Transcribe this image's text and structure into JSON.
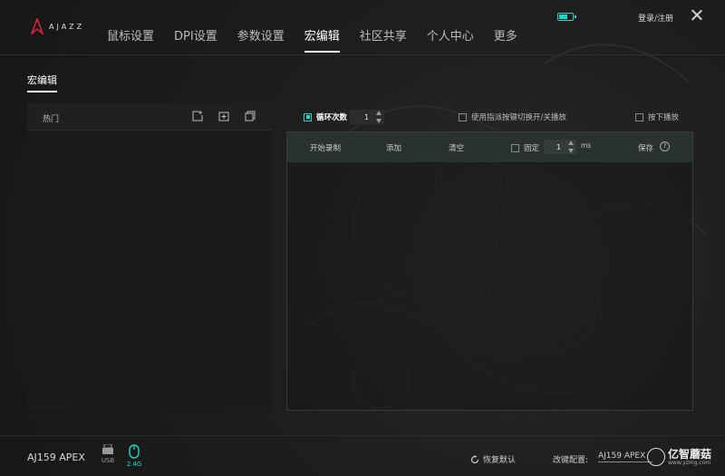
{
  "header": {
    "logo_text": "AJAZZ",
    "nav": [
      {
        "label": "鼠标设置",
        "active": false
      },
      {
        "label": "DPI设置",
        "active": false
      },
      {
        "label": "参数设置",
        "active": false
      },
      {
        "label": "宏编辑",
        "active": true
      },
      {
        "label": "社区共享",
        "active": false
      },
      {
        "label": "个人中心",
        "active": false
      },
      {
        "label": "更多",
        "active": false
      }
    ],
    "login_label": "登录/注册",
    "battery_level": 0.7
  },
  "page_title": "宏编辑",
  "left_panel": {
    "header_label": "热门",
    "icons": [
      "new-file-icon",
      "add-folder-icon",
      "copy-icon"
    ]
  },
  "options": {
    "loop_label": "循环次数",
    "loop_checked": true,
    "loop_value": "1",
    "toggle_label": "使用指派按键切换开/关播放",
    "press_label": "按下播放"
  },
  "toolbar": {
    "record_label": "开始录制",
    "add_label": "添加",
    "clear_label": "清空",
    "fixed_label": "固定",
    "fixed_value": "1",
    "unit": "ms",
    "save_label": "保存",
    "help_icon": "?"
  },
  "footer": {
    "device_name": "AJ159 APEX",
    "usb_label": "USB",
    "wireless_label": "2.4G",
    "restore_label": "恢复默认",
    "profile_label": "改键配置:",
    "profile_value": "AJ159 APEX"
  },
  "watermark": {
    "text": "亿智蘑菇",
    "sub": "www.yzmg.com"
  },
  "colors": {
    "accent": "#1ed9c8",
    "toolbar_bg": "#2a3231"
  }
}
